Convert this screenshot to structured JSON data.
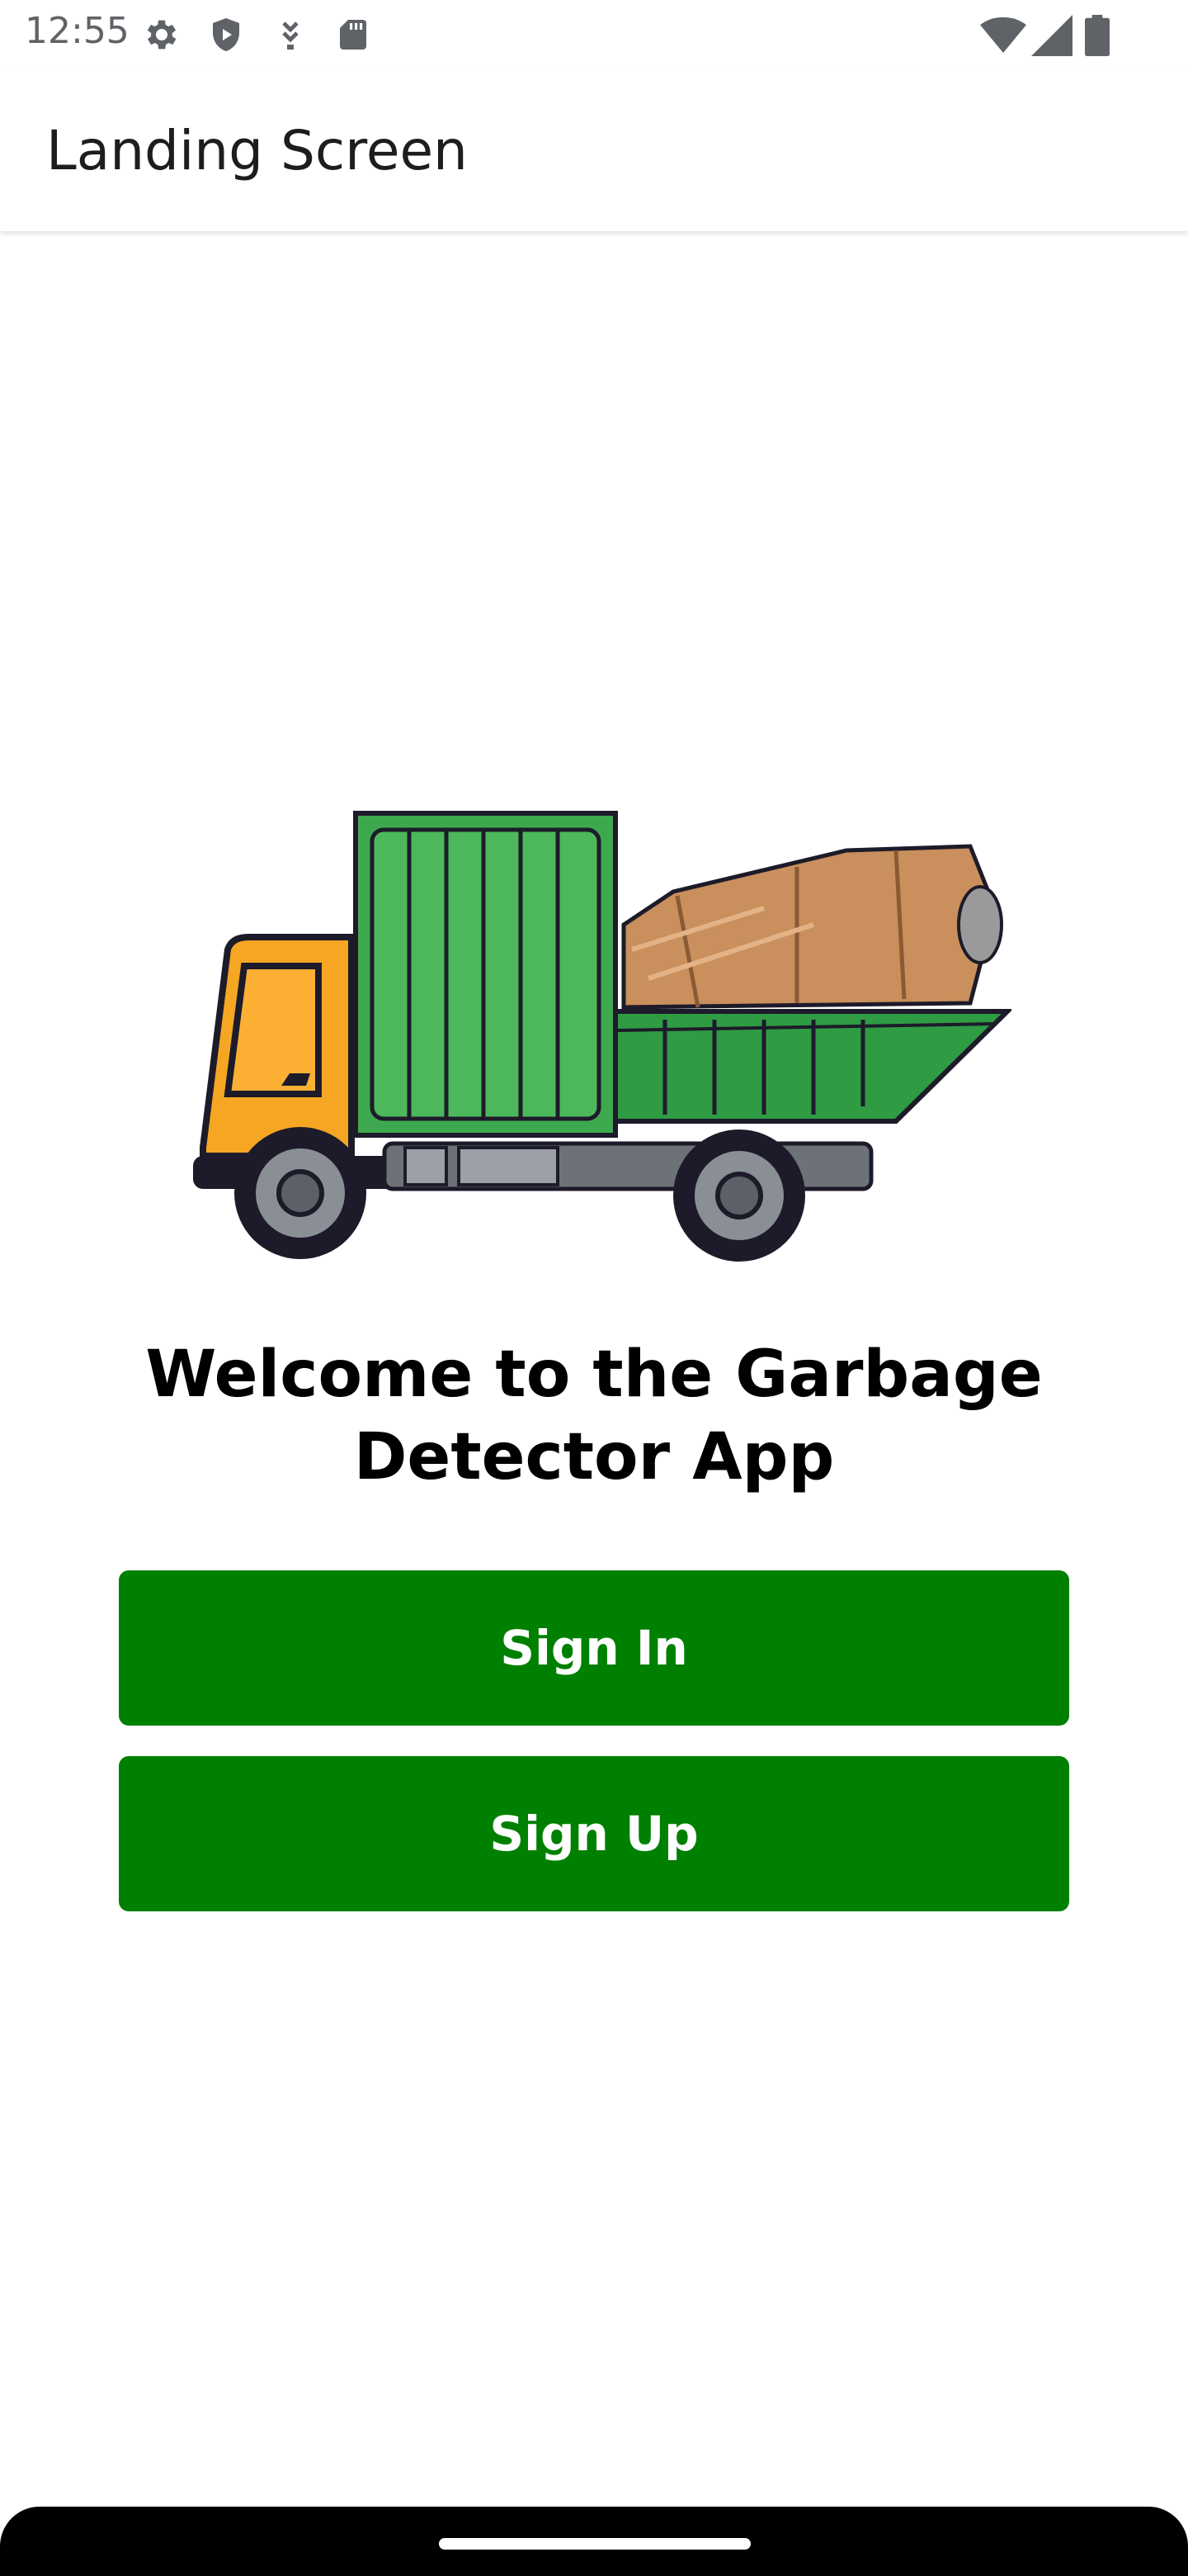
{
  "status_bar": {
    "time": "12:55",
    "left_icons": [
      "settings-gear-icon",
      "shield-icon",
      "download-arrow-icon",
      "sd-card-icon"
    ],
    "right_icons": [
      "wifi-icon",
      "cellular-signal-icon",
      "battery-icon"
    ],
    "icon_color": "#5f6368"
  },
  "app_bar": {
    "title": "Landing Screen"
  },
  "main": {
    "illustration": "garbage-truck-illustration",
    "welcome_line1": "Welcome to the Garbage",
    "welcome_line2": "Detector App",
    "sign_in_label": "Sign In",
    "sign_up_label": "Sign Up"
  },
  "colors": {
    "button_green": "#008000",
    "truck_container_green": "#3ea84e",
    "truck_cab_orange": "#f5a623",
    "cardboard_brown": "#c98f5c"
  }
}
